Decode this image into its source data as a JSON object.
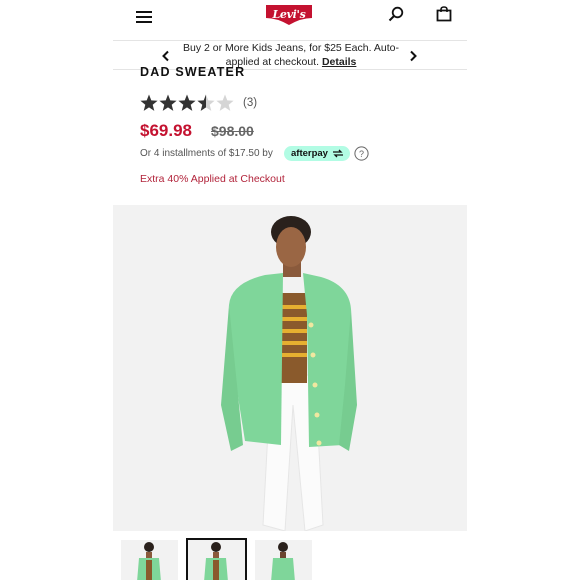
{
  "header": {
    "brand": "Levi's",
    "icons": [
      "menu-icon",
      "search-icon",
      "bag-icon"
    ]
  },
  "promo": {
    "text": "Buy 2 or More Kids Jeans, for $25 Each. Auto-applied at checkout.",
    "link": "Details"
  },
  "product": {
    "title": "DAD SWEATER",
    "rating": 3.5,
    "rating_max": 5,
    "review_count": "(3)",
    "price": "$69.98",
    "original_price": "$98.00",
    "installments": "Or 4 installments of $17.50 by",
    "afterpay_label": "afterpay",
    "extra_offer": "Extra 40% Applied at Checkout"
  },
  "gallery": {
    "selected_thumbnail": 2,
    "thumbnail_count": 3
  },
  "colors": {
    "brand_red": "#c41230",
    "price_red": "#c41230",
    "offer_red": "#b2243b",
    "afterpay_mint": "#b2fce4",
    "sweater_green": "#7fd69a"
  }
}
